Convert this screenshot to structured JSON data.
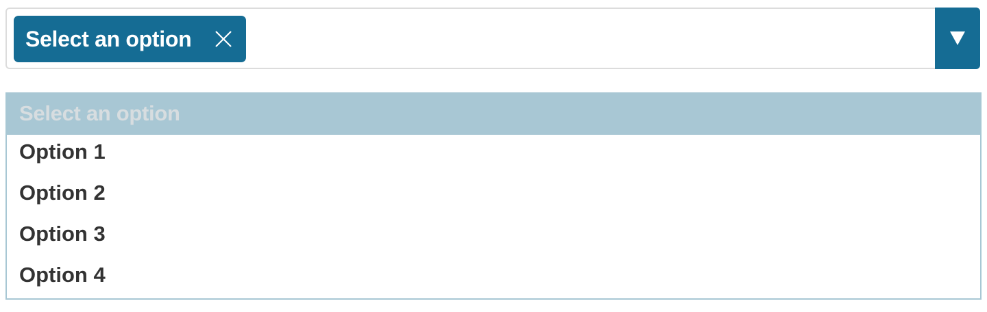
{
  "select": {
    "chip_label": "Select an option",
    "toggle_icon": "triangle-down-icon",
    "chip_close_icon": "close-icon",
    "accent_color": "#156c94"
  },
  "dropdown": {
    "placeholder": "Select an option",
    "header_color": "#a8c7d4",
    "options": [
      {
        "label": "Option 1"
      },
      {
        "label": "Option 2"
      },
      {
        "label": "Option 3"
      },
      {
        "label": "Option 4"
      }
    ]
  }
}
